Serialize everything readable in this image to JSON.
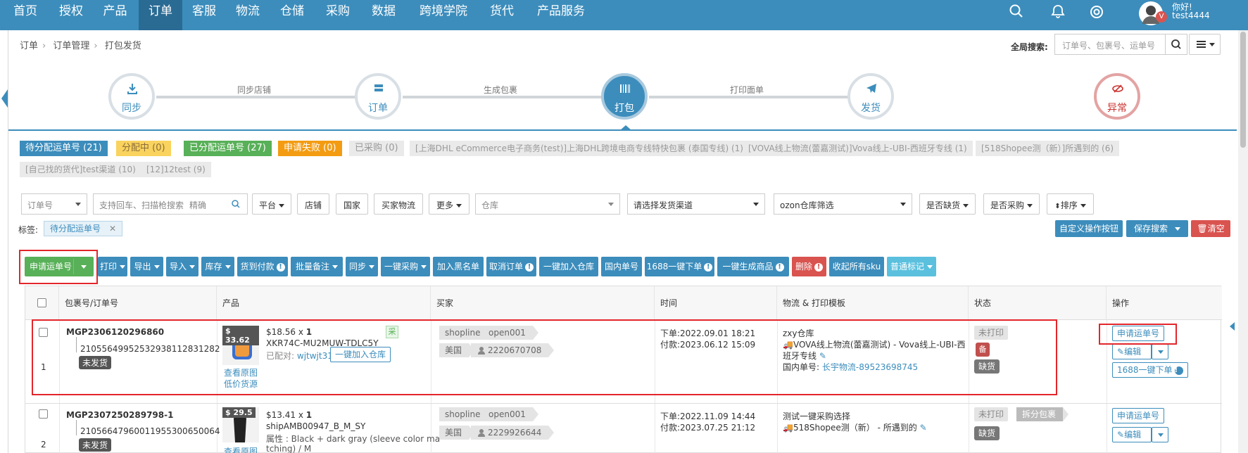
{
  "nav": {
    "items": [
      "首页",
      "授权",
      "产品",
      "订单",
      "客服",
      "物流",
      "仓储",
      "采购",
      "数据",
      "跨境学院",
      "货代",
      "产品服务"
    ],
    "active_index": 3,
    "greeting": "你好!",
    "username": "test4444",
    "avatar_badge": "V"
  },
  "breadcrumb": [
    "订单",
    "订单管理",
    "打包发货"
  ],
  "global_search": {
    "label": "全局搜索:",
    "placeholder": "订单号、包裹号、运单号"
  },
  "steps": {
    "circles": [
      "同步",
      "订单",
      "打包",
      "发货",
      "异常"
    ],
    "connectors": [
      "同步店铺",
      "生成包裹",
      "打印面单"
    ],
    "active_index": 2
  },
  "tags": [
    {
      "label": "待分配运单号 (21)",
      "style": "blue"
    },
    {
      "label": "分配中 (0)",
      "style": "yellow"
    },
    {
      "label": "已分配运单号 (27)",
      "style": "green"
    },
    {
      "label": "申请失败 (0)",
      "style": "orange"
    },
    {
      "label": "已采购 (0)",
      "style": "gray"
    },
    {
      "label": "[上海DHL eCommerce电子商务(test)]上海DHL跨境电商专线特快包裹 (泰国专线) (1)",
      "style": "gray"
    },
    {
      "label": "[VOVA线上物流(蕾嘉测试)]Vova线上-UBI-西班牙专线 (1)",
      "style": "gray"
    },
    {
      "label": "[518Shopee测（新）]所遇到的 (6)",
      "style": "gray"
    },
    {
      "label": "[自己找的货代]test渠道 (10)",
      "style": "gray"
    },
    {
      "label": "[12]12test (9)",
      "style": "gray"
    }
  ],
  "filters": {
    "order_no": "订单号",
    "search_placeholder": "支持回车、扫描枪搜索",
    "precise": "精确",
    "platform": "平台",
    "store": "店铺",
    "country": "国家",
    "buyer_logistics": "买家物流",
    "more": "更多",
    "warehouse": "仓库",
    "channel": "请选择发货渠道",
    "ozon": "ozon仓库筛选",
    "out_of_stock": "是否缺货",
    "purchased": "是否采购",
    "sort": "排序"
  },
  "label_row": {
    "label": "标签:",
    "tag": "待分配运单号"
  },
  "right_actions": {
    "custom": "自定义操作按钮",
    "save": "保存搜索",
    "clear": "清空"
  },
  "toolbar": [
    {
      "label": "申请运单号",
      "style": "green",
      "split": true
    },
    {
      "label": "打印",
      "style": "blue",
      "caret": true
    },
    {
      "label": "导出",
      "style": "blue",
      "caret": true
    },
    {
      "label": "导入",
      "style": "blue",
      "caret": true
    },
    {
      "label": "库存",
      "style": "blue",
      "caret": true
    },
    {
      "label": "货到付款",
      "style": "blue",
      "excl": true
    },
    {
      "label": "批量备注",
      "style": "blue",
      "caret": true
    },
    {
      "label": "同步",
      "style": "blue",
      "caret": true
    },
    {
      "label": "一键采购",
      "style": "blue",
      "caret": true
    },
    {
      "label": "加入黑名单",
      "style": "blue"
    },
    {
      "label": "取消订单",
      "style": "blue",
      "excl": true
    },
    {
      "label": "一键加入仓库",
      "style": "blue"
    },
    {
      "label": "国内单号",
      "style": "blue"
    },
    {
      "label": "1688一键下单",
      "style": "blue",
      "excl": true
    },
    {
      "label": "一键生成商品",
      "style": "blue",
      "excl": true
    },
    {
      "label": "删除",
      "style": "red",
      "excl": true
    },
    {
      "label": "收起所有sku",
      "style": "blue"
    },
    {
      "label": "普通标记",
      "style": "sky",
      "caret": true
    }
  ],
  "table": {
    "headers": [
      "包裹号/订单号",
      "产品",
      "买家",
      "时间",
      "物流 & 打印模板",
      "状态",
      "操作"
    ],
    "rows": [
      {
        "index": "1",
        "package_no": "MGP2306120296860",
        "order_no": "2105564995253293811283128​2",
        "ship_status": "未发货",
        "price": "$ 33.62",
        "unit_price": "$18.56",
        "qty": "1",
        "sku": "XKR74C-MU2MUW-TDLC5Y",
        "matched_label": "已配对:",
        "matched_value": "wjtwjt3111",
        "add_warehouse": "一键加入仓库",
        "purchase_mark": "采",
        "view_image": "查看原图",
        "cheap_source": "低价货源",
        "shop": "shopline",
        "store": "open001",
        "country": "美国",
        "buyer_id": "2220670708",
        "order_time": "下单:2022.09.01 18:21",
        "pay_time": "付款:2023.06.12 15:09",
        "warehouse": "zxy仓库",
        "logistics": "VOVA线上物流(蕾嘉测试) - Vova线上-UBI-西",
        "logistics2": "班牙专线",
        "domestic_label": "国内单号:",
        "domestic_value": "长宇物流-89523698745",
        "print_status": "未打印",
        "note_mark": "备",
        "stock_status": "缺货",
        "apply_btn": "申请运单号",
        "edit_btn": "编辑",
        "order1688_btn": "1688一键下单"
      },
      {
        "index": "2",
        "package_no": "MGP2307250289798-1",
        "order_no": "2105664796001195530065006​4",
        "ship_status": "未发货",
        "price": "$ 29.5",
        "unit_price": "$13.41",
        "qty": "1",
        "sku": "shipAMB00947_B_M_SY",
        "attr": "属性 : Black + dark gray (sleeve color ma",
        "attr2": "tching) / M",
        "view_image": "查看原图",
        "shop": "shopline",
        "store": "open001",
        "country": "美国",
        "buyer_id": "2229926644",
        "order_time": "下单:2022.11.09 14:44",
        "pay_time": "付款:2023.07.25 21:12",
        "warehouse": "测试一键采购选择",
        "logistics": "518Shopee测（新） - 所遇到的",
        "print_status": "未打印",
        "split_tag": "拆分包裹",
        "stock_status": "缺货",
        "apply_btn": "申请运单号",
        "edit_btn": "编辑"
      }
    ]
  },
  "colors": {
    "primary": "#3c8dbc",
    "green": "#58b058",
    "red": "#d9534f",
    "highlight": "#e3262b"
  }
}
